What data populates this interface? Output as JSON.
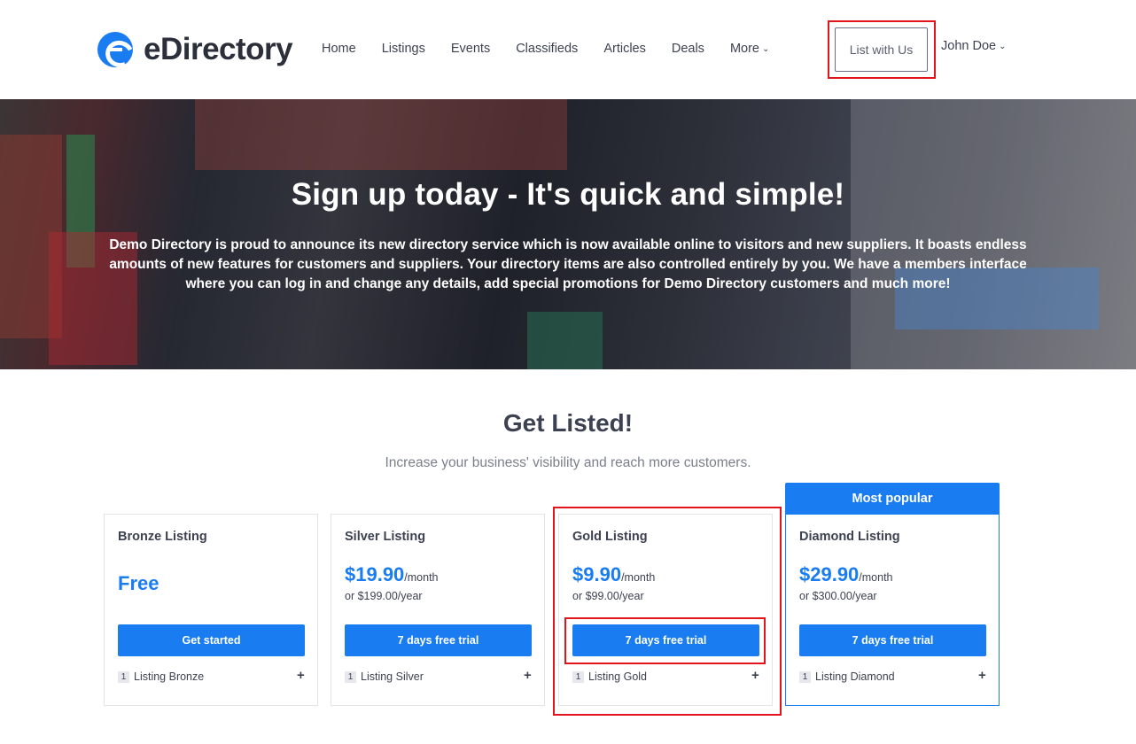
{
  "header": {
    "logo_text": "eDirectory",
    "nav": [
      "Home",
      "Listings",
      "Events",
      "Classifieds",
      "Articles",
      "Deals",
      "More"
    ],
    "list_with_us": "List with Us",
    "user_name": "John Doe",
    "chevron": "⌄"
  },
  "hero": {
    "title": "Sign up today - It's quick and simple!",
    "text": "Demo Directory is proud to announce its new directory service which is now available online to visitors and new suppliers. It boasts endless amounts of new features for customers and suppliers. Your directory items are also controlled entirely by you. We have a members interface where you can log in and change any details, add special promotions for Demo Directory customers and much more!"
  },
  "pricing": {
    "title": "Get Listed!",
    "subtitle": "Increase your business' visibility and reach more customers.",
    "popular_label": "Most popular",
    "plans": [
      {
        "name": "Bronze Listing",
        "price": "Free",
        "per": "",
        "yearly": "",
        "button": "Get started",
        "feature_count": "1",
        "feature": "Listing Bronze"
      },
      {
        "name": "Silver Listing",
        "price": "$19.90",
        "per": "/month",
        "yearly": "or $199.00/year",
        "button": "7 days free trial",
        "feature_count": "1",
        "feature": "Listing Silver"
      },
      {
        "name": "Gold Listing",
        "price": "$9.90",
        "per": "/month",
        "yearly": "or $99.00/year",
        "button": "7 days free trial",
        "feature_count": "1",
        "feature": "Listing Gold"
      },
      {
        "name": "Diamond Listing",
        "price": "$29.90",
        "per": "/month",
        "yearly": "or $300.00/year",
        "button": "7 days free trial",
        "feature_count": "1",
        "feature": "Listing Diamond"
      }
    ],
    "plus": "+"
  },
  "colors": {
    "accent": "#1a7cf1",
    "highlight": "#e3141b",
    "text": "#3d4252"
  }
}
